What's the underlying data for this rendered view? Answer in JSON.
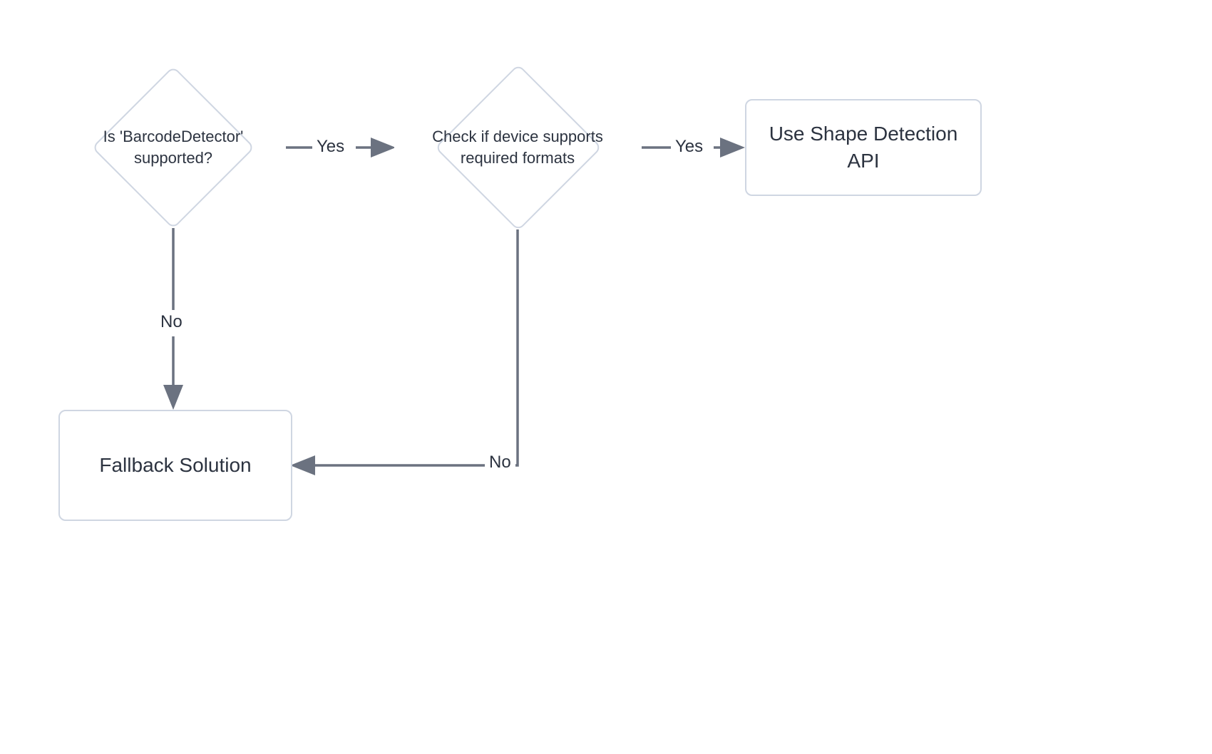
{
  "nodes": {
    "decision1": {
      "line1": "Is 'BarcodeDetector'",
      "line2": "supported?"
    },
    "decision2": {
      "line1": "Check if device supports",
      "line2": "required formats"
    },
    "result_api": "Use Shape Detection API",
    "result_fallback": "Fallback Solution"
  },
  "edges": {
    "d1_yes": "Yes",
    "d1_no": "No",
    "d2_yes": "Yes",
    "d2_no": "No"
  },
  "colors": {
    "node_border": "#cfd6e2",
    "text": "#2c3340",
    "arrow": "#6b7280"
  }
}
